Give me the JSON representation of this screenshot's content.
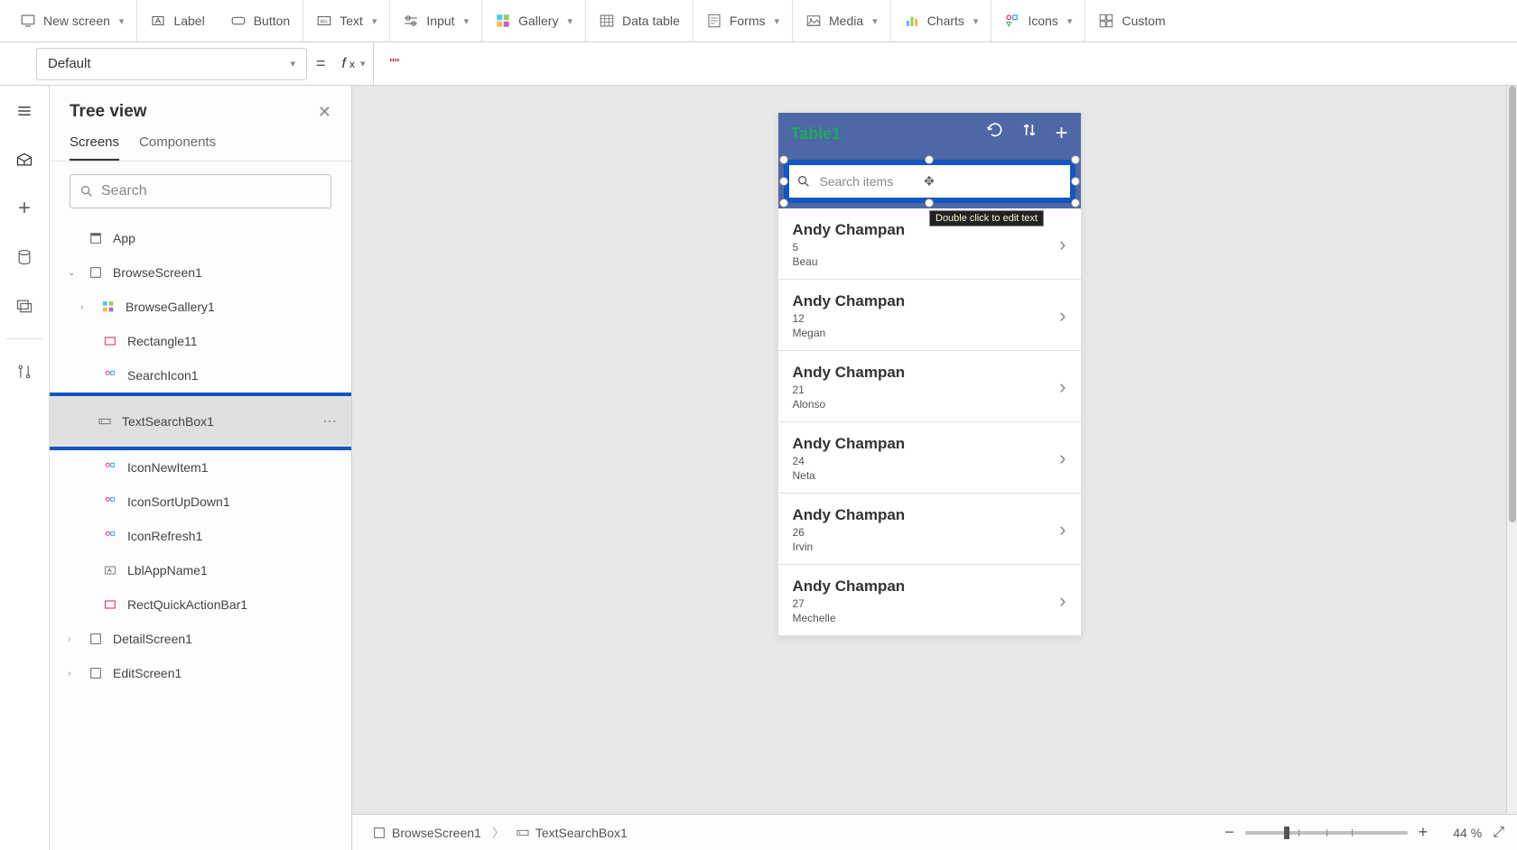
{
  "toolbar": {
    "newscreen": "New screen",
    "label": "Label",
    "button": "Button",
    "text": "Text",
    "input": "Input",
    "gallery": "Gallery",
    "datatable": "Data table",
    "forms": "Forms",
    "media": "Media",
    "charts": "Charts",
    "icons": "Icons",
    "custom": "Custom"
  },
  "formulaBar": {
    "property": "Default",
    "fx": "fx",
    "value": "\"\""
  },
  "tree": {
    "title": "Tree view",
    "tabs": {
      "screens": "Screens",
      "components": "Components"
    },
    "searchPlaceholder": "Search",
    "items": {
      "app": "App",
      "browseScreen": "BrowseScreen1",
      "browseGallery": "BrowseGallery1",
      "rectangle11": "Rectangle11",
      "searchIcon1": "SearchIcon1",
      "textSearchBox1": "TextSearchBox1",
      "iconNewItem1": "IconNewItem1",
      "iconSortUpDown1": "IconSortUpDown1",
      "iconRefresh1": "IconRefresh1",
      "lblAppName1": "LblAppName1",
      "rectQuickActionBar1": "RectQuickActionBar1",
      "detailScreen1": "DetailScreen1",
      "editScreen1": "EditScreen1"
    }
  },
  "canvas": {
    "headerTitle": "Table1",
    "searchPlaceholder": "Search items",
    "tooltip": "Double click to edit text",
    "items": [
      {
        "title": "Andy Champan",
        "sub1": "5",
        "sub2": "Beau"
      },
      {
        "title": "Andy Champan",
        "sub1": "12",
        "sub2": "Megan"
      },
      {
        "title": "Andy Champan",
        "sub1": "21",
        "sub2": "Alonso"
      },
      {
        "title": "Andy Champan",
        "sub1": "24",
        "sub2": "Neta"
      },
      {
        "title": "Andy Champan",
        "sub1": "26",
        "sub2": "Irvin"
      },
      {
        "title": "Andy Champan",
        "sub1": "27",
        "sub2": "Mechelle"
      }
    ]
  },
  "footer": {
    "bc1": "BrowseScreen1",
    "bc2": "TextSearchBox1",
    "zoom": "44",
    "pct": "%"
  }
}
